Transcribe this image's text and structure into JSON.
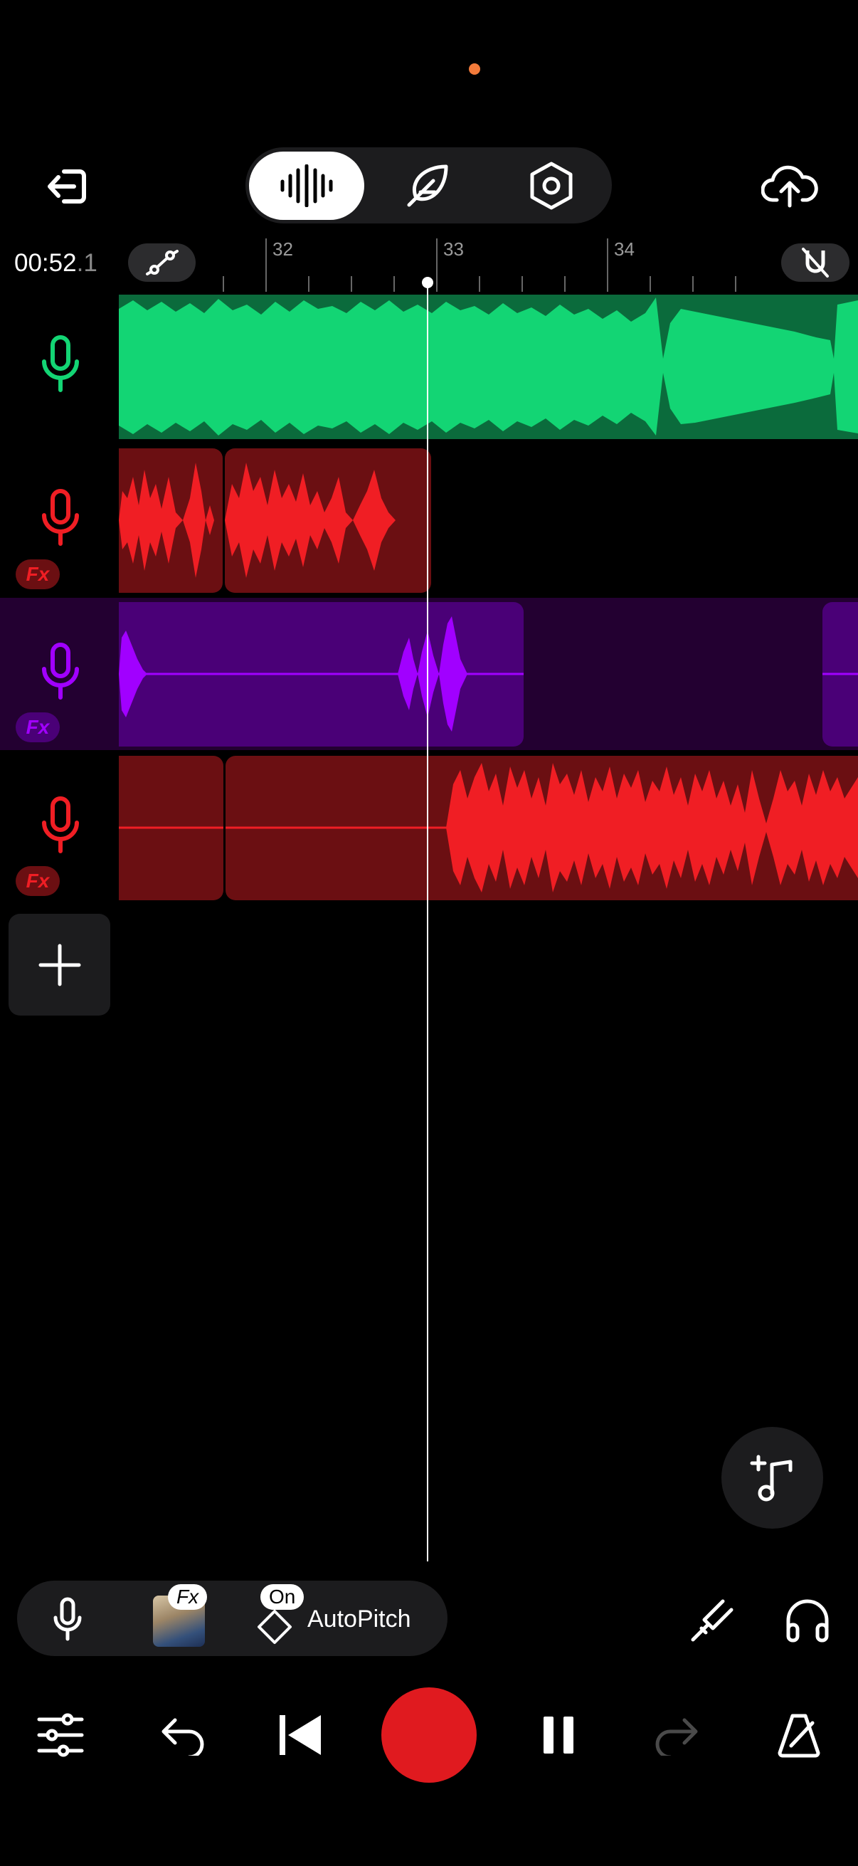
{
  "status": {
    "indicator_color": "#f27a3a"
  },
  "top": {
    "back_icon": "exit-icon",
    "modes": [
      {
        "name": "waveform-mode-icon",
        "active": true
      },
      {
        "name": "feather-mode-icon",
        "active": false
      },
      {
        "name": "hex-settings-icon",
        "active": false
      }
    ],
    "upload_icon": "cloud-upload-icon"
  },
  "timeline": {
    "time_main": "00:52",
    "time_fraction": ".1",
    "bar_labels": [
      "32",
      "33",
      "34"
    ],
    "automation_icon": "automation-icon",
    "magnet_icon": "magnet-off-icon"
  },
  "tracks": [
    {
      "name": "track-1",
      "color": "#13d574",
      "dark": "#0b6b3c",
      "fx": false
    },
    {
      "name": "track-2",
      "color": "#f01e24",
      "dark": "#6b0f12",
      "fx": true,
      "fx_label": "Fx"
    },
    {
      "name": "track-3",
      "color": "#a100ff",
      "dark": "#4a0077",
      "fx": true,
      "fx_label": "Fx",
      "selected": true
    },
    {
      "name": "track-4",
      "color": "#f01e24",
      "dark": "#6b0f12",
      "fx": true,
      "fx_label": "Fx"
    }
  ],
  "toolbar": {
    "fx_badge": "Fx",
    "on_badge": "On",
    "autopitch_label": "AutoPitch"
  },
  "transport": {
    "mixer_icon": "sliders-icon",
    "undo_icon": "undo-icon",
    "rewind_icon": "skip-back-icon",
    "record_color": "#e01a1f",
    "pause_icon": "pause-icon",
    "redo_icon": "redo-icon",
    "metronome_icon": "metronome-icon"
  }
}
